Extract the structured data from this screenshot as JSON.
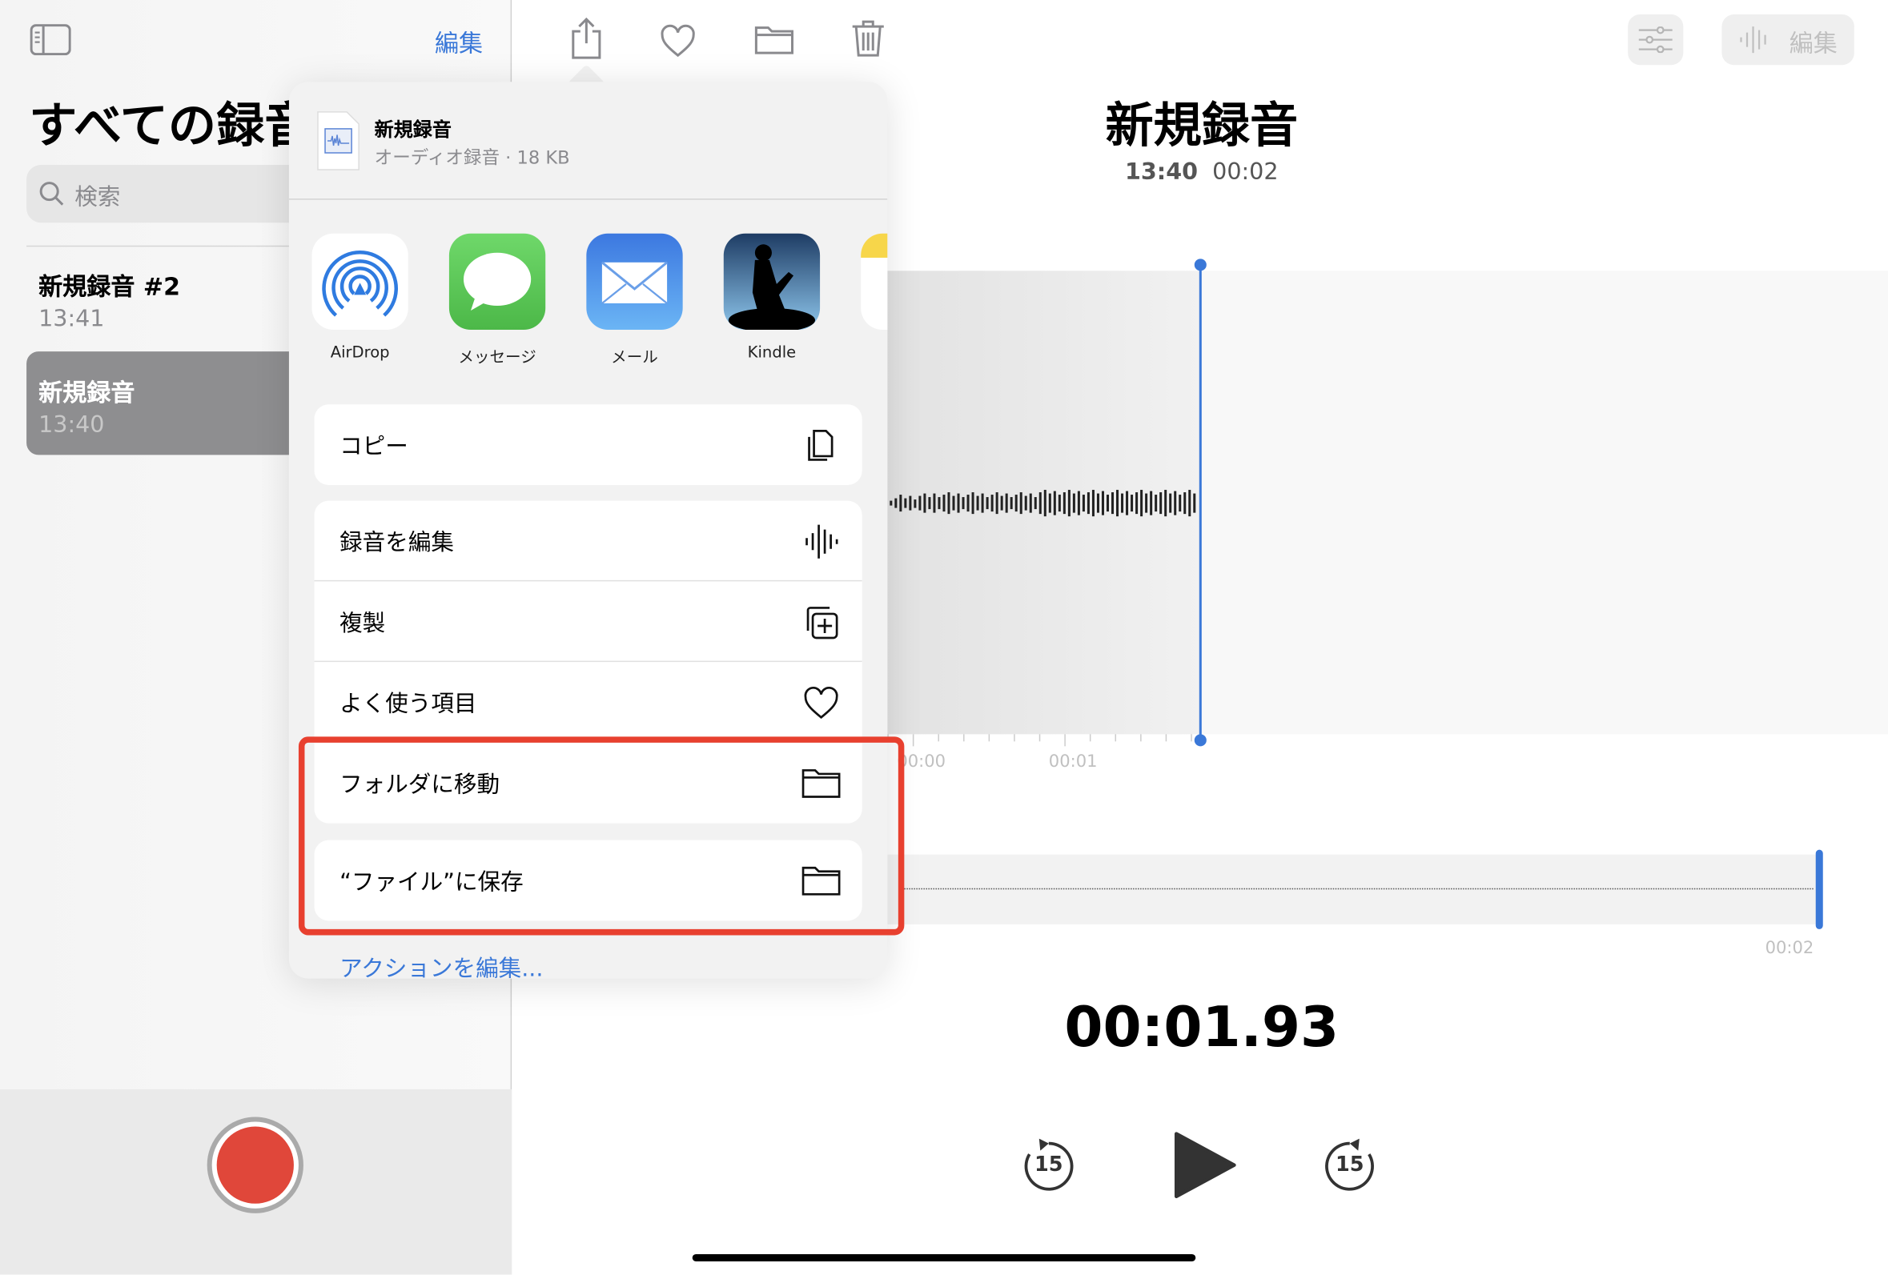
{
  "sidebar": {
    "edit_label": "編集",
    "title": "すべての録音",
    "search_placeholder": "検索",
    "recordings": [
      {
        "name": "新規録音 #2",
        "time": "13:41",
        "selected": false
      },
      {
        "name": "新規録音",
        "time": "13:40",
        "selected": true
      }
    ]
  },
  "toolbar": {
    "icons": [
      "share-icon",
      "heart-icon",
      "folder-icon",
      "trash-icon"
    ],
    "edit_label": "編集"
  },
  "share_sheet": {
    "file_title": "新規録音",
    "file_subtitle": "オーディオ録音 · 18 KB",
    "apps": [
      {
        "label": "AirDrop"
      },
      {
        "label": "メッセージ"
      },
      {
        "label": "メール"
      },
      {
        "label": "Kindle"
      }
    ],
    "actions": [
      {
        "label": "コピー",
        "icon": "copy-icon"
      },
      {
        "label": "録音を編集",
        "icon": "waveform-icon"
      },
      {
        "label": "複製",
        "icon": "duplicate-icon"
      },
      {
        "label": "よく使う項目",
        "icon": "heart-icon"
      },
      {
        "label": "フォルダに移動",
        "icon": "folder-icon"
      },
      {
        "label": "“ファイル”に保存",
        "icon": "folder-icon"
      }
    ],
    "edit_actions_label": "アクションを編集..."
  },
  "detail": {
    "title": "新規録音",
    "time": "13:40",
    "duration": "00:02",
    "timeline_labels": [
      "00:00",
      "00:01"
    ],
    "overview_end_label": "00:02",
    "current_time": "00:01.93",
    "skip_back": "15",
    "skip_forward": "15"
  },
  "colors": {
    "accent": "#3a78d8",
    "highlight_box": "#e8402f",
    "record": "#e0473a"
  }
}
